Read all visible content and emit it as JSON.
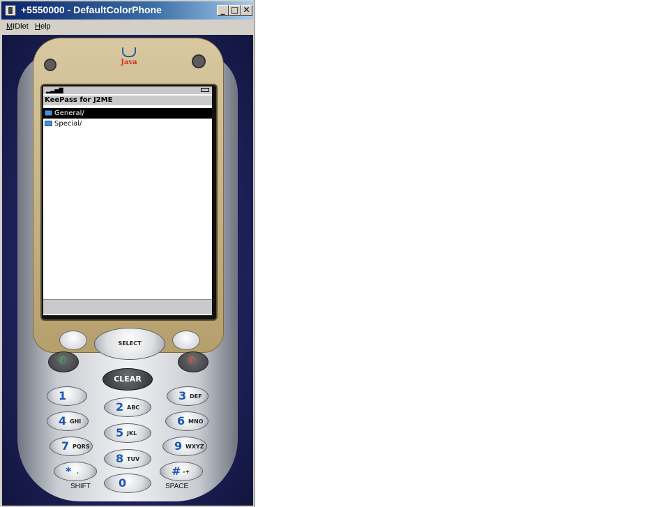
{
  "window": {
    "title": "+5550000 - DefaultColorPhone",
    "minimize_glyph": "_",
    "maximize_glyph": "□",
    "close_glyph": "✕"
  },
  "menu": {
    "items": [
      {
        "accel": "M",
        "rest": "IDlet"
      },
      {
        "accel": "H",
        "rest": "elp"
      }
    ]
  },
  "phone": {
    "brand_text": "Java",
    "screen": {
      "title": "KeePass for J2ME",
      "items": [
        {
          "label": "General/",
          "selected": true
        },
        {
          "label": "Special/",
          "selected": false
        }
      ]
    },
    "nav": {
      "select_label": "SELECT"
    },
    "clear_label": "CLEAR",
    "keys": [
      {
        "num": "1",
        "sub": ""
      },
      {
        "num": "2",
        "sub": "ABC"
      },
      {
        "num": "3",
        "sub": "DEF"
      },
      {
        "num": "4",
        "sub": "GHI"
      },
      {
        "num": "5",
        "sub": "JKL"
      },
      {
        "num": "6",
        "sub": "MNO"
      },
      {
        "num": "7",
        "sub": "PQRS"
      },
      {
        "num": "8",
        "sub": "TUV"
      },
      {
        "num": "9",
        "sub": "WXYZ"
      },
      {
        "num": "*",
        "sub": "."
      },
      {
        "num": "0",
        "sub": ""
      },
      {
        "num": "#",
        "sub": "-+"
      }
    ],
    "shift_label": "SHIFT",
    "space_label": "SPACE"
  },
  "colors": {
    "titlebar_start": "#0a246a",
    "key_digit": "#1a58b5",
    "selection_bg": "#000000"
  }
}
